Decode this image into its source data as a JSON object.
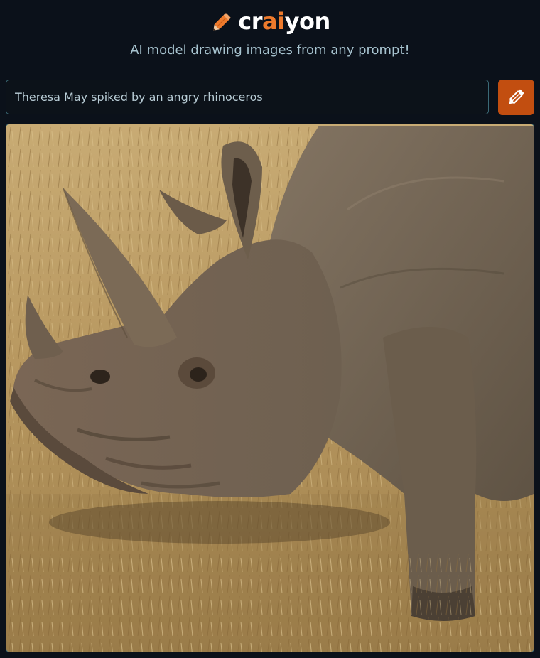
{
  "brand": {
    "name_prefix": "cr",
    "name_accent": "ai",
    "name_suffix": "yon",
    "accent_color": "#ee7a2c",
    "logo_icon": "pencil-icon"
  },
  "tagline": "AI model drawing images from any prompt!",
  "prompt": {
    "value": "Theresa May spiked by an angry rhinoceros",
    "placeholder": ""
  },
  "draw_button": {
    "icon": "pencil-icon",
    "color": "#c24e10"
  },
  "result_image": {
    "subject": "rhinoceros grazing in dry grassland"
  }
}
